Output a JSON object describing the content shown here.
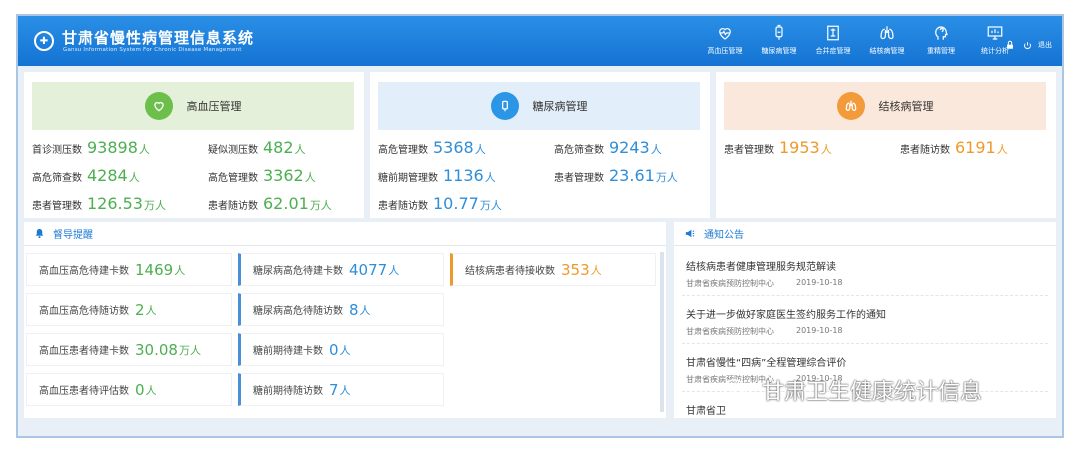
{
  "header": {
    "title": "甘肃省慢性病管理信息系统",
    "subtitle": "Gansu Information System For Chronic Disease Management",
    "nav": [
      {
        "label": "高血压管理",
        "icon": "heart-icon"
      },
      {
        "label": "糖尿病管理",
        "icon": "drip-bag-icon"
      },
      {
        "label": "合并症管理",
        "icon": "document-icon"
      },
      {
        "label": "结核病管理",
        "icon": "lungs-icon"
      },
      {
        "label": "重精管理",
        "icon": "head-icon"
      },
      {
        "label": "统计分析",
        "icon": "monitor-icon"
      }
    ],
    "logout": "退出"
  },
  "cards": {
    "hypertension": {
      "title": "高血压管理",
      "stats": [
        {
          "label": "首诊测压数",
          "value": "93898",
          "unit": "人"
        },
        {
          "label": "疑似测压数",
          "value": "482",
          "unit": "人"
        },
        {
          "label": "高危筛查数",
          "value": "4284",
          "unit": "人"
        },
        {
          "label": "高危管理数",
          "value": "3362",
          "unit": "人"
        },
        {
          "label": "患者管理数",
          "value": "126.53",
          "unit": "万人"
        },
        {
          "label": "患者随访数",
          "value": "62.01",
          "unit": "万人"
        }
      ]
    },
    "diabetes": {
      "title": "糖尿病管理",
      "stats": [
        {
          "label": "高危管理数",
          "value": "5368",
          "unit": "人"
        },
        {
          "label": "高危筛查数",
          "value": "9243",
          "unit": "人"
        },
        {
          "label": "糖前期管理数",
          "value": "1136",
          "unit": "人"
        },
        {
          "label": "患者管理数",
          "value": "23.61",
          "unit": "万人"
        },
        {
          "label": "患者随访数",
          "value": "10.77",
          "unit": "万人"
        }
      ]
    },
    "tuberculosis": {
      "title": "结核病管理",
      "stats": [
        {
          "label": "患者管理数",
          "value": "1953",
          "unit": "人"
        },
        {
          "label": "患者随访数",
          "value": "6191",
          "unit": "人"
        }
      ]
    }
  },
  "reminder": {
    "title": "督导提醒",
    "items": [
      {
        "label": "高血压高危待建卡数",
        "value": "1469",
        "unit": "人"
      },
      {
        "label": "糖尿病高危待建卡数",
        "value": "4077",
        "unit": "人"
      },
      {
        "label": "结核病患者待接收数",
        "value": "353",
        "unit": "人"
      },
      {
        "label": "高血压高危待随访数",
        "value": "2",
        "unit": "人"
      },
      {
        "label": "糖尿病高危待随访数",
        "value": "8",
        "unit": "人"
      },
      {
        "label": "高血压患者待建卡数",
        "value": "30.08",
        "unit": "万人"
      },
      {
        "label": "糖前期待建卡数",
        "value": "0",
        "unit": "人"
      },
      {
        "label": "高血压患者待评估数",
        "value": "0",
        "unit": "人"
      },
      {
        "label": "糖前期待随访数",
        "value": "7",
        "unit": "人"
      }
    ]
  },
  "notice": {
    "title": "通知公告",
    "items": [
      {
        "title": "结核病患者健康管理服务规范解读",
        "source": "甘肃省疾病预防控制中心",
        "date": "2019-10-18"
      },
      {
        "title": "关于进一步做好家庭医生签约服务工作的通知",
        "source": "甘肃省疾病预防控制中心",
        "date": "2019-10-18"
      },
      {
        "title": "甘肃省慢性“四病”全程管理综合评价",
        "source": "甘肃省疾病预防控制中心",
        "date": "2019-10-18"
      },
      {
        "title": "甘肃省卫",
        "source": "",
        "date": ""
      }
    ]
  },
  "watermark": "甘肃卫生健康统计信息",
  "colors": {
    "header": "#1a7fdc",
    "green": "#4caf50",
    "blue": "#2f8ed8",
    "orange": "#ee9a2a"
  }
}
